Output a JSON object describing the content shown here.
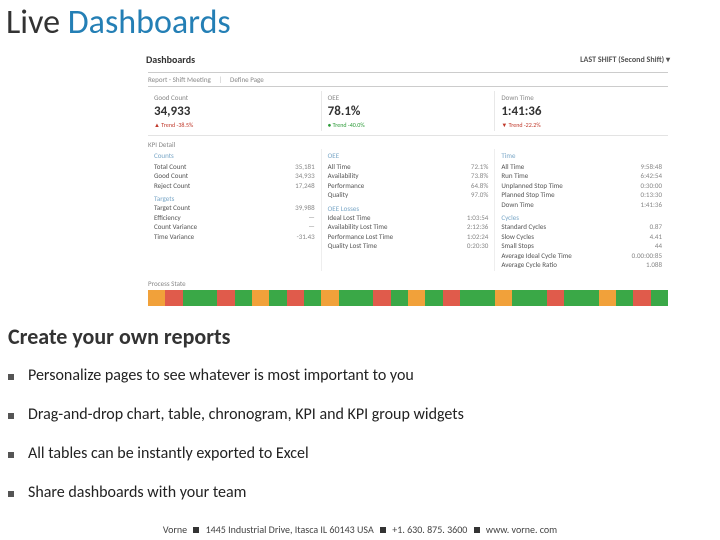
{
  "title_word1": "Live",
  "title_word2": "Dashboards",
  "screenshot": {
    "header_left": "Dashboards",
    "header_right": "LAST SHIFT (Second Shift) ▾",
    "report_label": "Report - Shift Meeting",
    "report_opts": "Define Page",
    "kpis": [
      {
        "label": "Good Count",
        "value": "34,933",
        "trend": "▲ Trend -38.5%",
        "trend_class": "tred"
      },
      {
        "label": "OEE",
        "value": "78.1%",
        "trend": "● Trend -40.0%",
        "trend_class": "tgrn"
      },
      {
        "label": "Down Time",
        "value": "1:41:36",
        "trend": "▼ Trend -22.2%",
        "trend_class": "tred"
      }
    ],
    "kpi_detail_label": "KPI Detail",
    "detail_cols": [
      {
        "head": "Counts",
        "rows": [
          {
            "k": "Total Count",
            "v": "35,181"
          },
          {
            "k": "Good Count",
            "v": "34,933"
          },
          {
            "k": "Reject Count",
            "v": "17,248"
          }
        ],
        "sub": "Targets",
        "rows2": [
          {
            "k": "Target Count",
            "v": "39,988"
          },
          {
            "k": "Efficiency",
            "v": "—"
          },
          {
            "k": "Count Variance",
            "v": "—"
          },
          {
            "k": "Time Variance",
            "v": "-31.43"
          }
        ]
      },
      {
        "head": "OEE",
        "rows": [
          {
            "k": "All Time",
            "v": "72.1%"
          },
          {
            "k": "Availability",
            "v": "73.8%"
          },
          {
            "k": "Performance",
            "v": "64.8%"
          },
          {
            "k": "Quality",
            "v": "97.0%"
          }
        ],
        "sub": "OEE Losses",
        "rows2": [
          {
            "k": "Ideal Lost Time",
            "v": "1:03:54"
          },
          {
            "k": "Availability Lost Time",
            "v": "2:12:36"
          },
          {
            "k": "Performance Lost Time",
            "v": "1:02:24"
          },
          {
            "k": "Quality Lost Time",
            "v": "0:20:30"
          }
        ]
      },
      {
        "head": "Time",
        "rows": [
          {
            "k": "All Time",
            "v": "9:58:48"
          },
          {
            "k": "Run Time",
            "v": "6:42:54"
          },
          {
            "k": "Unplanned Stop Time",
            "v": "0:30:00"
          },
          {
            "k": "Planned Stop Time",
            "v": "0:13:30"
          },
          {
            "k": "Down Time",
            "v": "1:41:36"
          }
        ],
        "sub": "Cycles",
        "rows2": [
          {
            "k": "Standard Cycles",
            "v": "0.87"
          },
          {
            "k": "Slow Cycles",
            "v": "4.41"
          },
          {
            "k": "Small Stops",
            "v": "44"
          },
          {
            "k": "Average Ideal Cycle Time",
            "v": "0.00:00:85"
          },
          {
            "k": "Average Cycle Ratio",
            "v": "1.088"
          }
        ]
      }
    ],
    "process_label": "Process State"
  },
  "timeline_colors": [
    "#f1a13a",
    "#e05b4b",
    "#3aa847",
    "#3aa847",
    "#e05b4b",
    "#3aa847",
    "#f1a13a",
    "#3aa847",
    "#e05b4b",
    "#3aa847",
    "#f1a13a",
    "#3aa847",
    "#3aa847",
    "#e05b4b",
    "#3aa847",
    "#f1a13a",
    "#3aa847",
    "#e05b4b",
    "#3aa847",
    "#3aa847",
    "#f1a13a",
    "#3aa847",
    "#3aa847",
    "#e05b4b",
    "#3aa847",
    "#3aa847",
    "#f1a13a",
    "#3aa847",
    "#e05b4b",
    "#3aa847"
  ],
  "subtitle": "Create your own reports",
  "bullets": [
    "Personalize pages to see whatever is most important to you",
    "Drag-and-drop chart, table, chronogram, KPI and KPI group widgets",
    "All tables can be instantly exported to Excel",
    "Share dashboards with your team"
  ],
  "footer": {
    "company": "Vorne",
    "address": "1445 Industrial Drive, Itasca IL 60143 USA",
    "phone": "+1. 630. 875. 3600",
    "url": "www. vorne. com"
  }
}
